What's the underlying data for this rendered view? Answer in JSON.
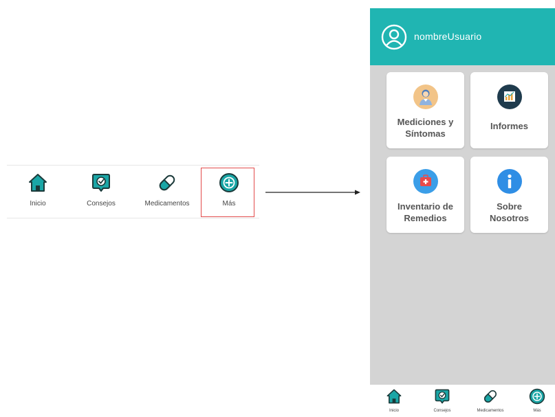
{
  "bottom_nav": {
    "items": [
      {
        "label": "Inicio",
        "icon": "home-icon"
      },
      {
        "label": "Consejos",
        "icon": "chat-check-icon"
      },
      {
        "label": "Medicamentos",
        "icon": "pill-icon"
      },
      {
        "label": "Más",
        "icon": "plus-circle-icon"
      }
    ]
  },
  "phone": {
    "header": {
      "username": "nombreUsuario",
      "icon": "user-avatar-icon"
    },
    "cards": [
      {
        "label": "Mediciones y\nSíntomas",
        "icon": "doctor-icon"
      },
      {
        "label": "Informes",
        "icon": "chart-icon"
      },
      {
        "label": "Inventario de\nRemedios",
        "icon": "medkit-icon"
      },
      {
        "label": "Sobre\nNosotros",
        "icon": "info-icon"
      }
    ],
    "bottom_nav": {
      "items": [
        {
          "label": "Inicio"
        },
        {
          "label": "Consejos"
        },
        {
          "label": "Medicamentos"
        },
        {
          "label": "Más"
        }
      ]
    }
  },
  "colors": {
    "teal": "#20b5b2",
    "dark_teal": "#1b3a3a",
    "icon_teal": "#1aa6a6",
    "highlight": "#e24a4a",
    "background_gray": "#d4d4d4"
  }
}
